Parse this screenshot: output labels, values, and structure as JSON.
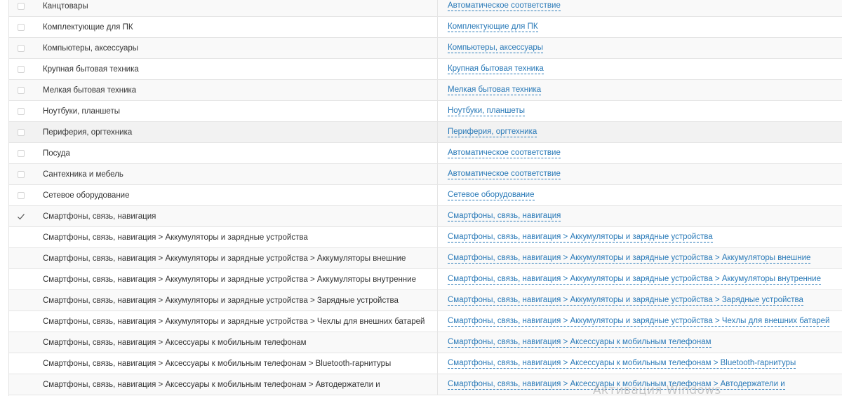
{
  "rows": [
    {
      "name": "Канцтовары",
      "mapping": "Автоматическое соответствие",
      "checked": false,
      "has_checkbox": true
    },
    {
      "name": "Комплектующие для ПК",
      "mapping": "Комплектующие для ПК",
      "checked": false,
      "has_checkbox": true
    },
    {
      "name": "Компьютеры, аксессуары",
      "mapping": "Компьютеры, аксессуары",
      "checked": false,
      "has_checkbox": true
    },
    {
      "name": "Крупная бытовая техника",
      "mapping": "Крупная бытовая техника",
      "checked": false,
      "has_checkbox": true
    },
    {
      "name": "Мелкая бытовая техника",
      "mapping": "Мелкая бытовая техника",
      "checked": false,
      "has_checkbox": true
    },
    {
      "name": "Ноутбуки, планшеты",
      "mapping": "Ноутбуки, планшеты",
      "checked": false,
      "has_checkbox": true
    },
    {
      "name": "Периферия, оргтехника",
      "mapping": "Периферия, оргтехника",
      "checked": false,
      "has_checkbox": true
    },
    {
      "name": "Посуда",
      "mapping": "Автоматическое соответствие",
      "checked": false,
      "has_checkbox": true
    },
    {
      "name": "Сантехника и мебель",
      "mapping": "Автоматическое соответствие",
      "checked": false,
      "has_checkbox": true
    },
    {
      "name": "Сетевое оборудование",
      "mapping": "Сетевое оборудование",
      "checked": false,
      "has_checkbox": true
    },
    {
      "name": "Смартфоны, связь, навигация",
      "mapping": "Смартфоны, связь, навигация",
      "checked": true,
      "has_checkbox": true
    },
    {
      "name": "Смартфоны, связь, навигация > Аккумуляторы и зарядные устройства",
      "mapping": "Смартфоны, связь, навигация  >  Аккумуляторы и зарядные устройства",
      "checked": false,
      "has_checkbox": false
    },
    {
      "name": "Смартфоны, связь, навигация > Аккумуляторы и зарядные устройства > Аккумуляторы внешние",
      "mapping": "Смартфоны, связь, навигация  >  Аккумуляторы и зарядные устройства  >  Аккумуляторы внешние",
      "checked": false,
      "has_checkbox": false
    },
    {
      "name": "Смартфоны, связь, навигация > Аккумуляторы и зарядные устройства > Аккумуляторы внутренние",
      "mapping": "Смартфоны, связь, навигация  >  Аккумуляторы и зарядные устройства  >  Аккумуляторы внутренние",
      "checked": false,
      "has_checkbox": false
    },
    {
      "name": "Смартфоны, связь, навигация > Аккумуляторы и зарядные устройства > Зарядные устройства",
      "mapping": "Смартфоны, связь, навигация  >  Аккумуляторы и зарядные устройства  >  Зарядные устройства",
      "checked": false,
      "has_checkbox": false
    },
    {
      "name": "Смартфоны, связь, навигация > Аккумуляторы и зарядные устройства > Чехлы для внешних батарей",
      "mapping": "Смартфоны, связь, навигация  >  Аккумуляторы и зарядные устройства  >  Чехлы для внешних батарей",
      "checked": false,
      "has_checkbox": false
    },
    {
      "name": "Смартфоны, связь, навигация > Аксессуары к мобильным телефонам",
      "mapping": "Смартфоны, связь, навигация  >  Аксессуары к мобильным телефонам",
      "checked": false,
      "has_checkbox": false
    },
    {
      "name": "Смартфоны, связь, навигация > Аксессуары к мобильным телефонам > Bluetooth-гарнитуры",
      "mapping": "Смартфоны, связь, навигация  >  Аксессуары к мобильным телефонам  >  Bluetooth-гарнитуры",
      "checked": false,
      "has_checkbox": false
    },
    {
      "name": "Смартфоны, связь, навигация > Аксессуары к мобильным телефонам > Автодержатели и",
      "mapping": "Смартфоны, связь, навигация  >  Аксессуары к мобильным телефонам  >  Автодержатели и",
      "checked": false,
      "has_checkbox": false
    }
  ],
  "watermark": "Активация Windows",
  "colors": {
    "link": "#2a7ab8",
    "row_alt": "#f9f9f9",
    "row_highlight": "#f2f2f2",
    "border": "#e5e5e5"
  },
  "icons": {
    "checkbox": "checkbox-icon",
    "checked": "checkmark-icon"
  }
}
